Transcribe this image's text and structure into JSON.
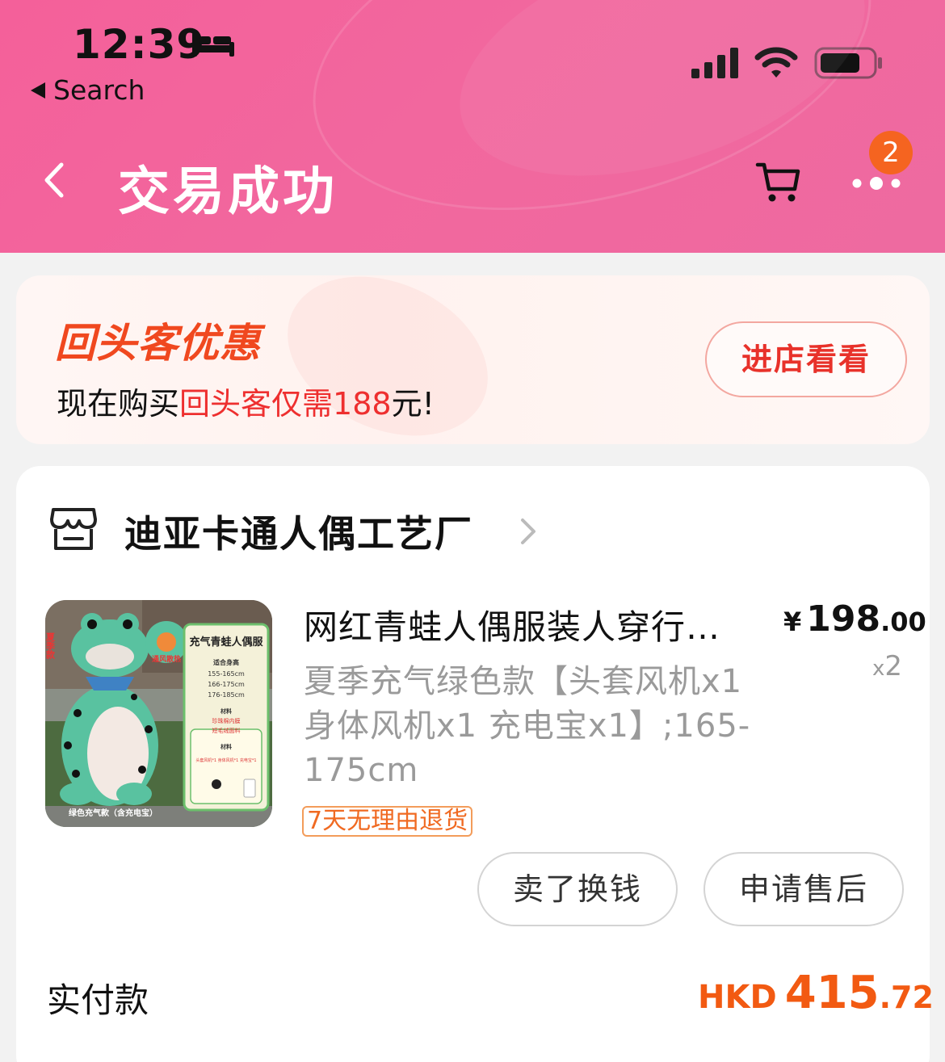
{
  "status_bar": {
    "time": "12:39",
    "back_app_label": "Search"
  },
  "nav": {
    "title": "交易成功",
    "more_badge": "2"
  },
  "promo": {
    "logo_text": "回头客优惠",
    "text_prefix": "现在购买",
    "text_highlight": "回头客仅需",
    "text_price": "188",
    "text_suffix": "元!",
    "button_label": "进店看看"
  },
  "order": {
    "shop_name": "迪亚卡通人偶工艺厂",
    "product": {
      "title": "网红青蛙人偶服装人穿行…",
      "sku": "夏季充气绿色款【头套风机x1 身体风机x1  充电宝x1】;165-175cm",
      "price_currency": "¥",
      "price_int": "198",
      "price_dec": ".00",
      "qty_prefix": "x",
      "qty": "2",
      "return_tag": "7天无理由退货",
      "image_texts": {
        "title": "充气青蛙人偶服",
        "height_label": "适合身高",
        "heights": [
          "155-165cm",
          "166-175cm",
          "176-185cm"
        ],
        "material_label": "材料",
        "materials": [
          "珍珠棉内膜",
          "短毛绒面料"
        ],
        "config_label": "材料",
        "config": "头套风机*1 身体风机*1 充电宝*1",
        "bottom_caption": "绿色充气款（含充电宝）",
        "vent_label": "通风散热",
        "side_label": "夏季款"
      }
    },
    "buttons": {
      "sell": "卖了换钱",
      "service": "申请售后"
    },
    "paid": {
      "label": "实付款",
      "currency": "HKD",
      "int": "415",
      "dec": ".72"
    }
  },
  "colors": {
    "header_pink": "#f2659d",
    "accent_red": "#e8312a",
    "accent_orange": "#f25a12",
    "badge": "#f56420"
  }
}
